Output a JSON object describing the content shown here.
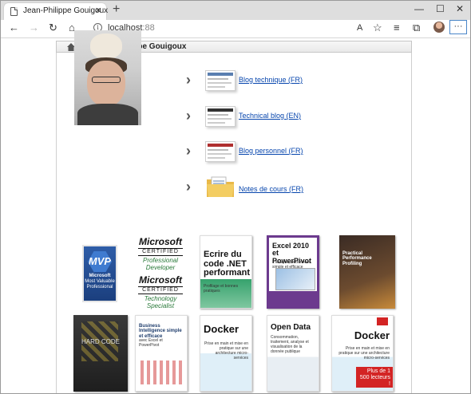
{
  "browser": {
    "tab_title": "Jean-Philippe Gouigoux",
    "address": "localhost",
    "address_port": ":88"
  },
  "breadcrumb": {
    "title": "Jean-Philippe Gouigoux"
  },
  "links": [
    {
      "label": "Blog technique (FR)"
    },
    {
      "label": "Technical blog (EN)"
    },
    {
      "label": "Blog personnel (FR)"
    },
    {
      "label": "Notes de cours (FR)"
    }
  ],
  "badges": {
    "mvp": {
      "logo": "MVP",
      "brand": "Microsoft",
      "line1": "Most Valuable",
      "line2": "Professional"
    },
    "mcp1": {
      "brand": "Microsoft",
      "cert": "CERTIFIED",
      "role1": "Professional",
      "role2": "Developer"
    },
    "mcp2": {
      "brand": "Microsoft",
      "cert": "CERTIFIED",
      "role1": "Technology",
      "role2": "Specialist"
    }
  },
  "books": [
    {
      "title": "Ecrire du code .NET performant",
      "sub": "Profilage et bonnes pratiques"
    },
    {
      "title": "Excel 2010 et PowerPivot",
      "sub": "L'analyse de données simple et efficace"
    },
    {
      "title": "Practical Performance Profiling",
      "sub": ""
    },
    {
      "title": "HARD CODE",
      "sub": ""
    },
    {
      "title": "Business Intelligence simple et efficace",
      "sub": "avec Excel et PowerPivot"
    },
    {
      "title": "Docker",
      "sub": "Prise en main et mise en pratique sur une architecture micro-services"
    },
    {
      "title": "Open Data",
      "sub": "Consommation, traitement, analyse et visualisation de la donnée publique"
    },
    {
      "title": "Docker",
      "sub": "Prise en main et mise en pratique sur une architecture micro-services",
      "ribbon": "Plus de 1 500 lecteurs !"
    }
  ]
}
